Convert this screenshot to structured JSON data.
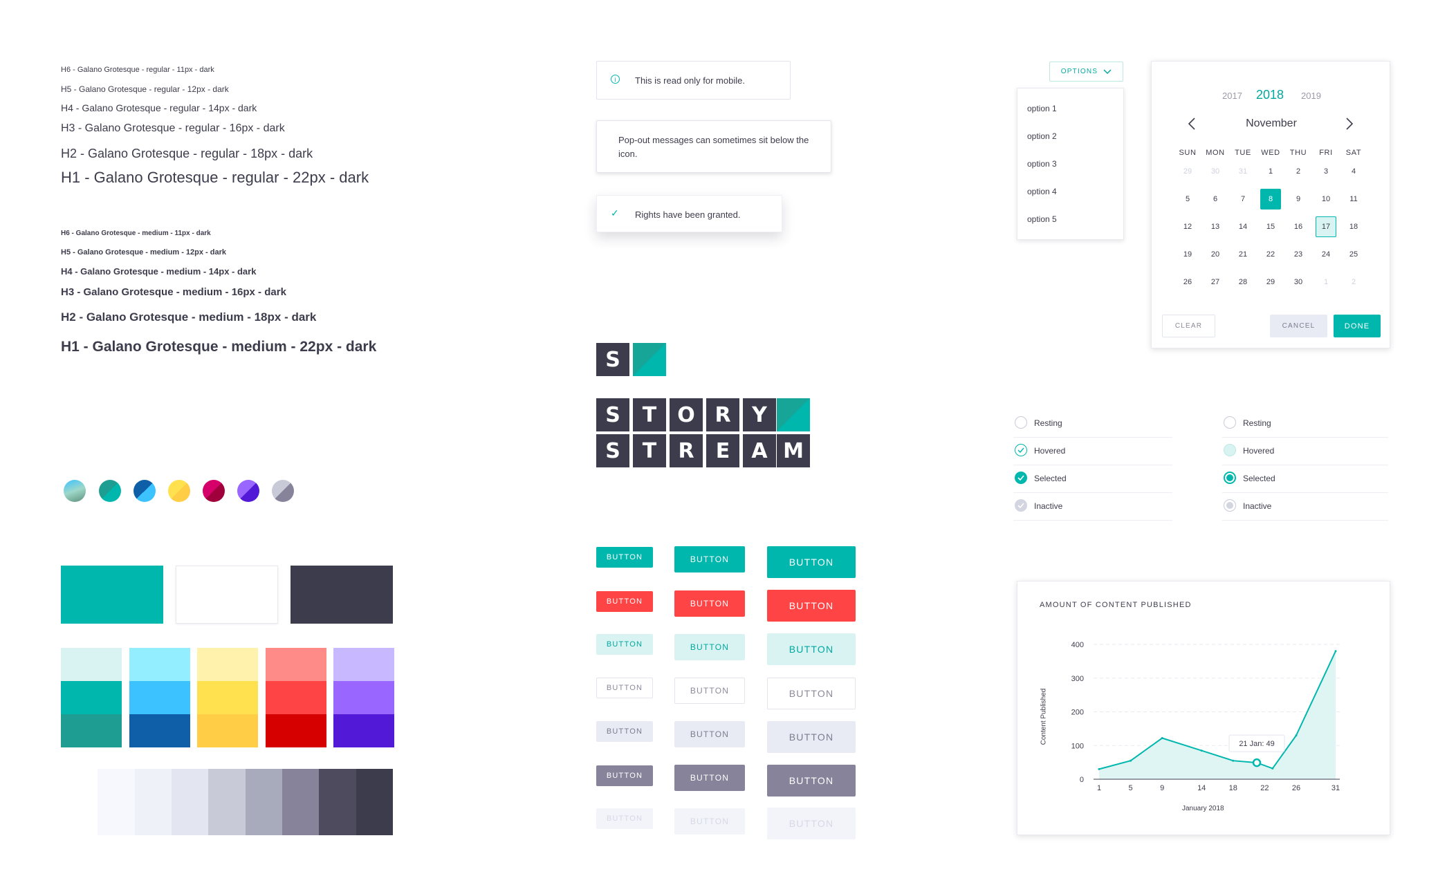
{
  "typography": {
    "regular": [
      "H6 - Galano Grotesque - regular - 11px - dark",
      "H5 - Galano Grotesque - regular - 12px - dark",
      "H4 - Galano Grotesque - regular - 14px - dark",
      "H3 - Galano Grotesque - regular - 16px - dark",
      "H2 - Galano Grotesque - regular - 18px - dark",
      "H1 - Galano Grotesque - regular - 22px - dark"
    ],
    "medium": [
      "H6 - Galano Grotesque - medium - 11px - dark",
      "H5 - Galano Grotesque - medium - 12px - dark",
      "H4 - Galano Grotesque - medium - 14px - dark",
      "H3 - Galano Grotesque - medium - 16px - dark",
      "H2 - Galano Grotesque - medium - 18px - dark",
      "H1 - Galano Grotesque - medium - 22px - dark"
    ]
  },
  "colors": {
    "primary": "#00b7ad",
    "white": "#ffffff",
    "dark": "#3d3c4c",
    "scales": [
      [
        "#d8f3f1",
        "#00b7ad",
        "#1e9e92"
      ],
      [
        "#93efff",
        "#3cc2ff",
        "#0f5fa8"
      ],
      [
        "#fff2ad",
        "#ffe14f",
        "#ffcd46"
      ],
      [
        "#ff8b88",
        "#ff4445",
        "#d60000"
      ],
      [
        "#c8b8ff",
        "#9966ff",
        "#5219d6"
      ]
    ],
    "greys": [
      "#ffffff",
      "#f7f8fd",
      "#eff1f8",
      "#e3e6f1",
      "#c8cad7",
      "#a8abbc",
      "#86839a",
      "#4e4b5e",
      "#3d3c4c"
    ]
  },
  "alerts": {
    "info": "This is read only for mobile.",
    "popout": "Pop-out messages can sometimes sit below the icon.",
    "success": "Rights have been granted."
  },
  "logo": {
    "mark": "S",
    "row1": [
      "S",
      "T",
      "O",
      "R",
      "Y"
    ],
    "row2": [
      "S",
      "T",
      "R",
      "E",
      "A",
      "M"
    ]
  },
  "buttons": {
    "label": "BUTTON"
  },
  "dropdown": {
    "label": "OPTIONS",
    "options": [
      "option 1",
      "option 2",
      "option 3",
      "option 4",
      "option 5"
    ]
  },
  "calendar": {
    "prev_year": "2017",
    "year": "2018",
    "next_year": "2019",
    "month": "November",
    "weekdays": [
      "SUN",
      "MON",
      "TUE",
      "WED",
      "THU",
      "FRI",
      "SAT"
    ],
    "weeks": [
      [
        "29",
        "30",
        "31",
        "1",
        "2",
        "3",
        "4"
      ],
      [
        "5",
        "6",
        "7",
        "8",
        "9",
        "10",
        "11"
      ],
      [
        "12",
        "13",
        "14",
        "15",
        "16",
        "17",
        "18"
      ],
      [
        "19",
        "20",
        "21",
        "22",
        "23",
        "24",
        "25"
      ],
      [
        "26",
        "27",
        "28",
        "29",
        "30",
        "1",
        "2"
      ]
    ],
    "selected": "8",
    "today": "17",
    "clear_label": "CLEAR",
    "cancel_label": "CANCEL",
    "done_label": "DONE"
  },
  "checkboxes": {
    "states": [
      "Resting",
      "Hovered",
      "Selected",
      "Inactive"
    ]
  },
  "chart_data": {
    "type": "area",
    "title": "AMOUNT OF CONTENT PUBLISHED",
    "xlabel": "January 2018",
    "ylabel": "Content Published",
    "x_ticks": [
      "1",
      "5",
      "9",
      "14",
      "18",
      "22",
      "26",
      "31"
    ],
    "y_ticks": [
      "0",
      "100",
      "200",
      "300",
      "400"
    ],
    "ylim": [
      0,
      400
    ],
    "xlim": [
      1,
      31
    ],
    "points": [
      {
        "x": 1,
        "y": 30
      },
      {
        "x": 5,
        "y": 55
      },
      {
        "x": 9,
        "y": 122
      },
      {
        "x": 14,
        "y": 85
      },
      {
        "x": 18,
        "y": 55
      },
      {
        "x": 21,
        "y": 49
      },
      {
        "x": 23,
        "y": 32
      },
      {
        "x": 26,
        "y": 130
      },
      {
        "x": 31,
        "y": 380
      }
    ],
    "tooltip": "21 Jan: 49",
    "color": "#00b7ad",
    "fill": "#dff5f3",
    "grid": true
  }
}
